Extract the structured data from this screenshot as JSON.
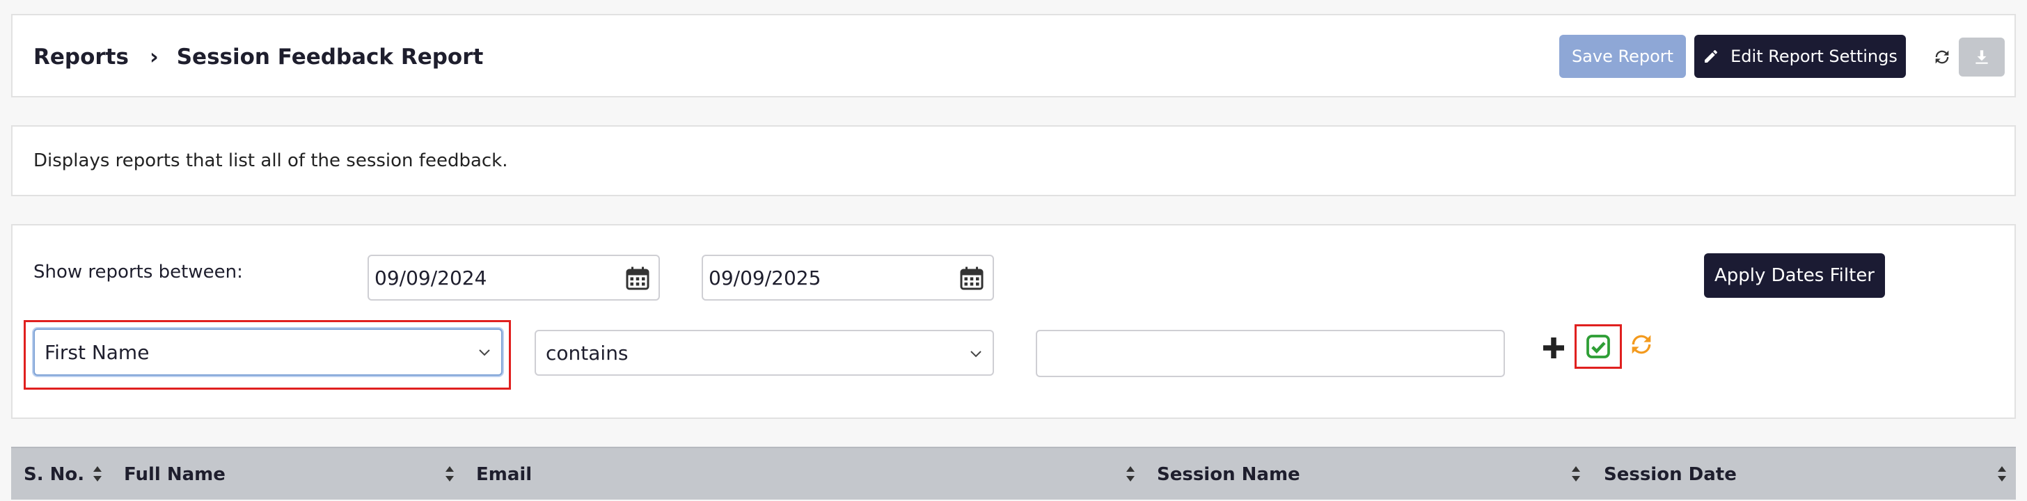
{
  "header": {
    "breadcrumb_root": "Reports",
    "breadcrumb_sep": "›",
    "breadcrumb_current": "Session Feedback Report",
    "save_label": "Save Report",
    "edit_label": "Edit Report Settings"
  },
  "description": "Displays reports that list all of the session feedback.",
  "filters": {
    "show_label": "Show reports between:",
    "date_from": "09/09/2024",
    "date_to": "09/09/2025",
    "apply_label": "Apply Dates Filter",
    "field_selected": "First Name",
    "operator_selected": "contains",
    "value": "",
    "value_placeholder": ""
  },
  "table": {
    "columns": [
      "S. No.",
      "Full Name",
      "Email",
      "Session Name",
      "Session Date"
    ]
  },
  "colors": {
    "primary_dark": "#1b1b33",
    "save_disabled": "#8ea7d6",
    "highlight": "#e0201f",
    "check_green": "#2e9e35",
    "reset_orange": "#f39a1e"
  },
  "icons": [
    "pencil-icon",
    "refresh-icon",
    "download-icon",
    "calendar-icon",
    "chevron-down-icon",
    "plus-icon",
    "check-square-icon",
    "reset-icon",
    "sort-icon"
  ]
}
